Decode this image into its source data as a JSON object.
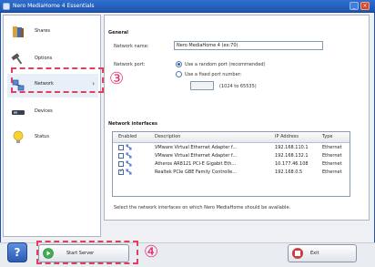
{
  "window": {
    "title": "Nero MediaHome 4 Essentials",
    "minimize": "_",
    "close": "×"
  },
  "sidebar": {
    "items": [
      {
        "label": "Shares",
        "icon": "shares-icon"
      },
      {
        "label": "Options",
        "icon": "options-icon"
      },
      {
        "label": "Network",
        "icon": "network-icon",
        "arrow": "›"
      },
      {
        "label": "Devices",
        "icon": "devices-icon"
      },
      {
        "label": "Status",
        "icon": "status-icon"
      }
    ]
  },
  "general": {
    "title": "General",
    "network_name_label": "Network name:",
    "network_name_value": "Nero MediaHome 4 (ex:70)",
    "network_port_label": "Network port:",
    "port_options": [
      "Use a random port (recommended)",
      "Use a fixed port number:"
    ],
    "port_value": "",
    "port_range": "(1024 to 65535)"
  },
  "interfaces": {
    "title": "Network interfaces",
    "columns": [
      "Enabled",
      "Description",
      "IP Address",
      "Type"
    ],
    "rows": [
      {
        "enabled": false,
        "description": "VMware Virtual Ethernet Adapter f...",
        "ip": "192.168.110.1",
        "type": "Ethernet"
      },
      {
        "enabled": false,
        "description": "VMware Virtual Ethernet Adapter f...",
        "ip": "192.168.132.1",
        "type": "Ethernet"
      },
      {
        "enabled": false,
        "description": "Atheros AR8121 PCI-E Gigabit Eth...",
        "ip": "10.177.46.108",
        "type": "Ethernet"
      },
      {
        "enabled": true,
        "description": "Realtek PCIe GBE Family Controlle...",
        "ip": "192.168.0.5",
        "type": "Ethernet"
      }
    ],
    "hint": "Select the network interfaces on which Nero MediaHome should be available."
  },
  "footer": {
    "help_label": "?",
    "start_server_label": "Start Server",
    "exit_label": "Exit"
  },
  "callouts": {
    "network": "③",
    "start_server": "④"
  },
  "colors": {
    "accent": "#e0306a",
    "titlebar": "#2e6fd0"
  }
}
